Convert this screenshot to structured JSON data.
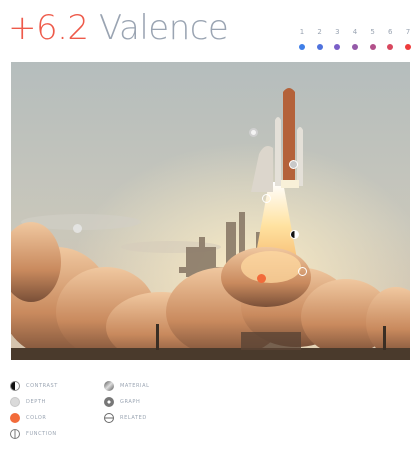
{
  "header": {
    "score": "+6.2",
    "title": "Valence"
  },
  "scale": {
    "labels": [
      "1",
      "2",
      "3",
      "4",
      "5",
      "6",
      "7"
    ],
    "colors": [
      "#3f7fe8",
      "#4f72dd",
      "#7a5fc8",
      "#945aa8",
      "#b2508a",
      "#d8475e",
      "#ee3b3b"
    ]
  },
  "photo": {
    "subject": "space-shuttle-launch",
    "markers": [
      "material",
      "contrast",
      "related",
      "function",
      "depth",
      "color",
      "graph"
    ]
  },
  "legend": {
    "contrast": "CONTRAST",
    "depth": "DEPTH",
    "color": "COLOR",
    "function": "FUNCTION",
    "material": "MATERIAL",
    "graph": "GRAPH",
    "related": "RELATED",
    "accent_color": "#f26b3a"
  }
}
